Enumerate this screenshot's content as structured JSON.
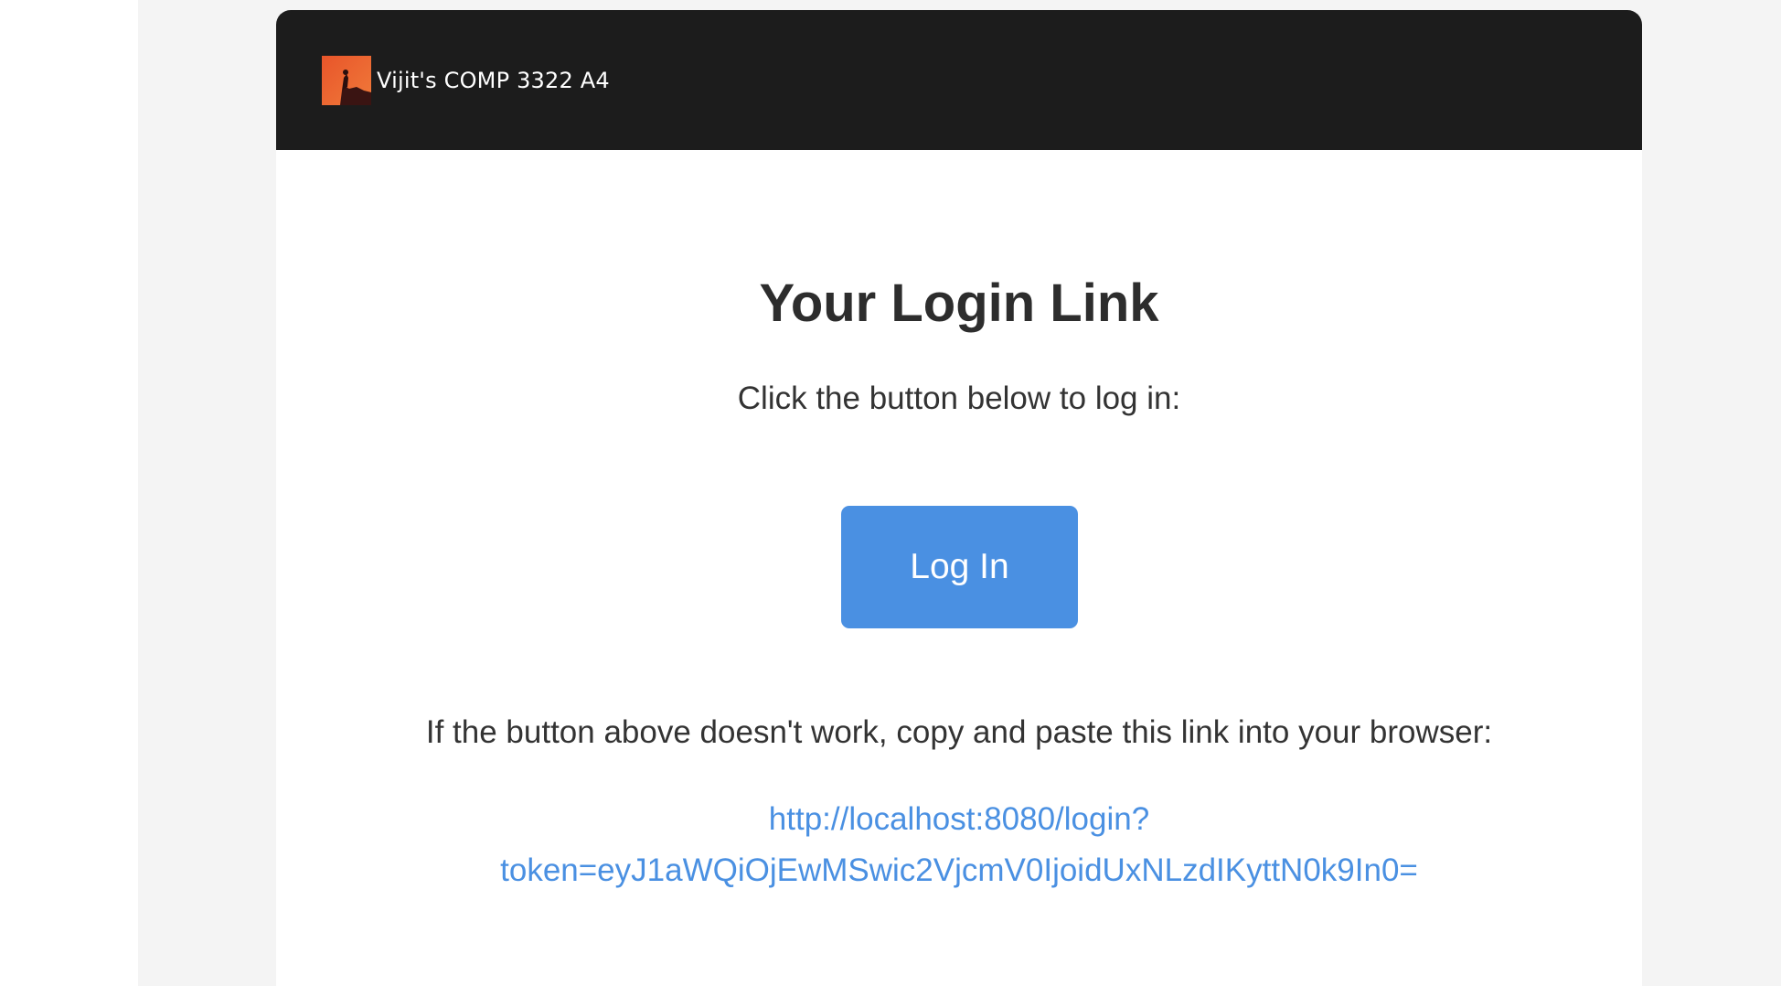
{
  "header": {
    "brand_name": "Vijit's COMP 3322 A4"
  },
  "main": {
    "title": "Your Login Link",
    "instruction": "Click the button below to log in:",
    "login_button_label": "Log In",
    "fallback_text": "If the button above doesn't work, copy and paste this link into your browser:",
    "login_url_line1": "http://localhost:8080/login?",
    "login_url_line2": "token=eyJ1aWQiOjEwMSwic2VjcmV0IjoidUxNLzdIKyttN0k9In0="
  },
  "colors": {
    "header_bg": "#1c1c1c",
    "accent": "#4a90e2",
    "page_bg": "#f4f4f4",
    "text": "#333333"
  }
}
